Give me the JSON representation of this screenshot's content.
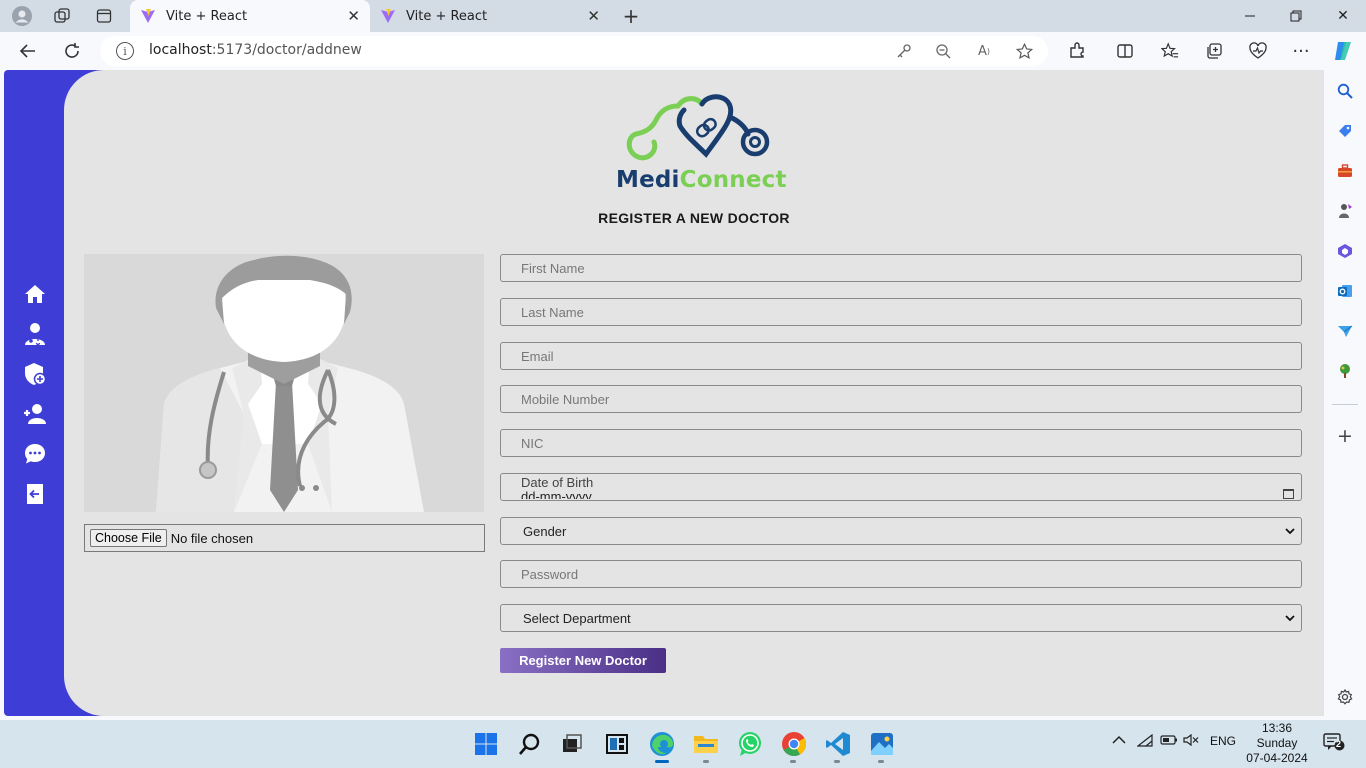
{
  "browser": {
    "tabs": [
      {
        "title": "Vite + React",
        "active": true
      },
      {
        "title": "Vite + React",
        "active": false
      }
    ],
    "url_host": "localhost",
    "url_path": ":5173/doctor/addnew"
  },
  "app": {
    "brand_part1": "Medi",
    "brand_part2": "Connect",
    "page_title": "REGISTER A NEW DOCTOR",
    "sidebar_icons": [
      "home-icon",
      "doctor-icon",
      "shield-add-icon",
      "user-add-icon",
      "chat-icon",
      "logout-icon"
    ],
    "file_input": {
      "button": "Choose File",
      "status": "No file chosen"
    },
    "form": {
      "first_name_placeholder": "First Name",
      "last_name_placeholder": "Last Name",
      "email_placeholder": "Email",
      "mobile_placeholder": "Mobile Number",
      "nic_placeholder": "NIC",
      "dob_label": "Date of Birth",
      "dob_placeholder": "dd-mm-yyyy",
      "gender_selected": "Gender",
      "password_placeholder": "Password",
      "department_selected": "Select Department",
      "submit_label": "Register New Doctor"
    },
    "colors": {
      "sidebar": "#3e3ed7",
      "brand_dark": "#193d6e",
      "brand_green": "#7bcf54",
      "button_from": "#8a70c4",
      "button_to": "#4a2f86"
    }
  },
  "taskbar": {
    "lang": "ENG",
    "time": "13:36",
    "day": "Sunday",
    "date": "07-04-2024",
    "notifications": "2"
  }
}
